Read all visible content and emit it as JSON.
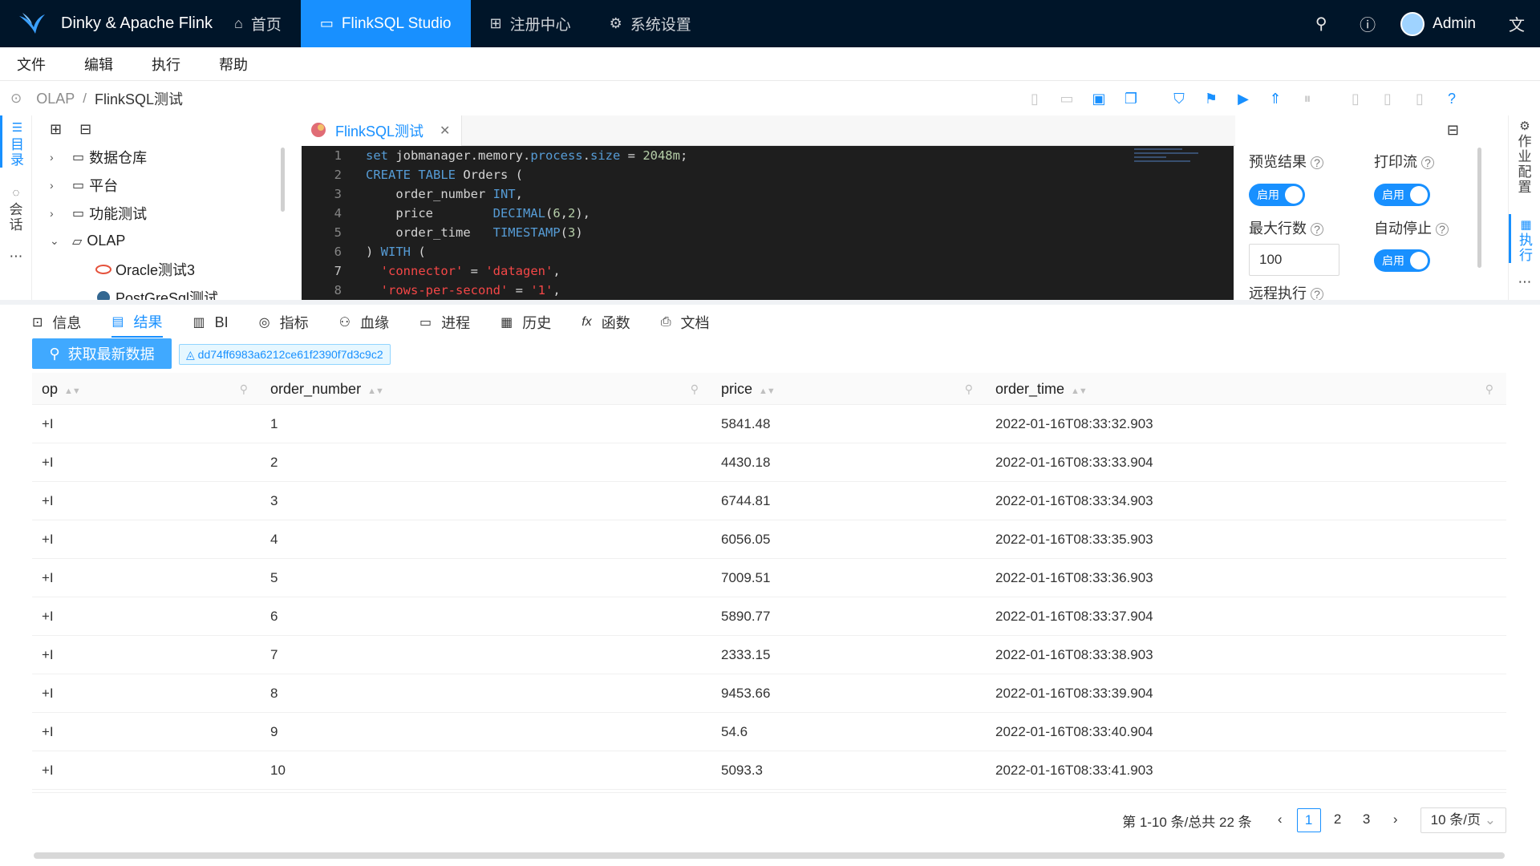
{
  "app": {
    "title": "Dinky & Apache Flink"
  },
  "nav": [
    {
      "label": "首页",
      "icon": "home-icon",
      "active": false
    },
    {
      "label": "FlinkSQL Studio",
      "icon": "studio-icon",
      "active": true
    },
    {
      "label": "注册中心",
      "icon": "grid-icon",
      "active": false
    },
    {
      "label": "系统设置",
      "icon": "gear-icon",
      "active": false
    }
  ],
  "user": {
    "name": "Admin"
  },
  "menu": [
    "文件",
    "编辑",
    "执行",
    "帮助"
  ],
  "breadcrumb": [
    "OLAP",
    "FlinkSQL测试"
  ],
  "left_tabs": [
    "目录",
    "会话"
  ],
  "tree": {
    "items": [
      {
        "label": "数据仓库"
      },
      {
        "label": "平台"
      },
      {
        "label": "功能测试"
      },
      {
        "label": "OLAP"
      }
    ],
    "children": [
      {
        "label": "Oracle测试3"
      },
      {
        "label": "PostGreSql测试"
      }
    ]
  },
  "editor": {
    "tab": "FlinkSQL测试",
    "line_numbers": [
      "1",
      "2",
      "3",
      "4",
      "5",
      "6",
      "7",
      "8"
    ]
  },
  "config": {
    "preview_label": "预览结果",
    "print_label": "打印流",
    "maxrows_label": "最大行数",
    "autostop_label": "自动停止",
    "remote_label": "远程执行",
    "switch_on": "启用",
    "maxrows_value": "100"
  },
  "right_tabs": [
    "作业配置",
    "执行"
  ],
  "bottom_tabs": [
    {
      "label": "信息",
      "icon": "terminal-icon"
    },
    {
      "label": "结果",
      "icon": "table-icon",
      "active": true
    },
    {
      "label": "BI",
      "icon": "bar-chart-icon"
    },
    {
      "label": "指标",
      "icon": "dashboard-icon"
    },
    {
      "label": "血缘",
      "icon": "lineage-icon"
    },
    {
      "label": "进程",
      "icon": "desktop-icon"
    },
    {
      "label": "历史",
      "icon": "calendar-icon"
    },
    {
      "label": "函数",
      "icon": "function-icon"
    },
    {
      "label": "文档",
      "icon": "doc-icon"
    }
  ],
  "results": {
    "fetch_label": "获取最新数据",
    "job_id": "dd74ff6983a6212ce61f2390f7d3c9c2",
    "columns": [
      "op",
      "order_number",
      "price",
      "order_time"
    ],
    "rows": [
      [
        "+I",
        "1",
        "5841.48",
        "2022-01-16T08:33:32.903"
      ],
      [
        "+I",
        "2",
        "4430.18",
        "2022-01-16T08:33:33.904"
      ],
      [
        "+I",
        "3",
        "6744.81",
        "2022-01-16T08:33:34.903"
      ],
      [
        "+I",
        "4",
        "6056.05",
        "2022-01-16T08:33:35.903"
      ],
      [
        "+I",
        "5",
        "7009.51",
        "2022-01-16T08:33:36.903"
      ],
      [
        "+I",
        "6",
        "5890.77",
        "2022-01-16T08:33:37.904"
      ],
      [
        "+I",
        "7",
        "2333.15",
        "2022-01-16T08:33:38.903"
      ],
      [
        "+I",
        "8",
        "9453.66",
        "2022-01-16T08:33:39.904"
      ],
      [
        "+I",
        "9",
        "54.6",
        "2022-01-16T08:33:40.904"
      ],
      [
        "+I",
        "10",
        "5093.3",
        "2022-01-16T08:33:41.903"
      ]
    ]
  },
  "pagination": {
    "total": "第 1-10 条/总共 22 条",
    "pages": [
      "1",
      "2",
      "3"
    ],
    "current": "1",
    "page_size": "10 条/页"
  }
}
